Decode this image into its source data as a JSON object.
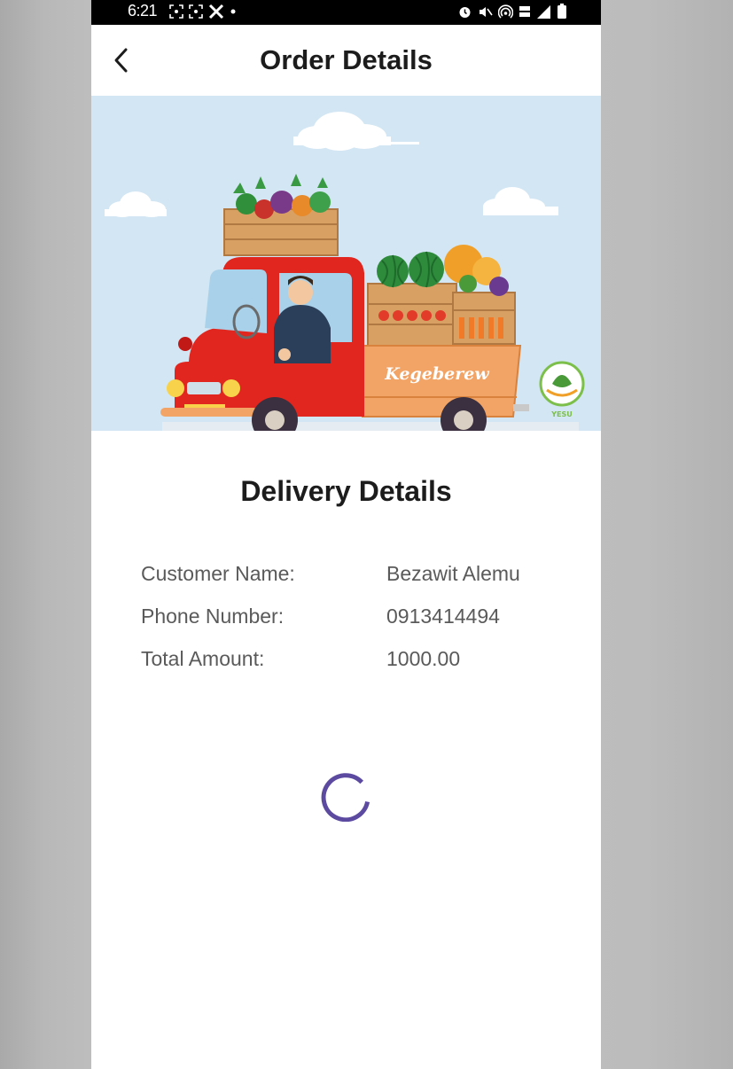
{
  "status_bar": {
    "time": "6:21",
    "left_icons": [
      "screenshot-icon",
      "screenshot-icon",
      "x-app-icon",
      "dot-icon"
    ],
    "right_icons": [
      "alarm-icon",
      "mute-icon",
      "hotspot-icon",
      "volte-icon",
      "signal-icon",
      "battery-icon"
    ]
  },
  "app_bar": {
    "title": "Order Details",
    "back_icon": "chevron-left-icon"
  },
  "banner": {
    "truck_label": "Kegeberew",
    "logo_text": "YESU"
  },
  "delivery": {
    "title": "Delivery Details",
    "rows": [
      {
        "label": "Customer Name:",
        "value": "Bezawit Alemu"
      },
      {
        "label": "Phone Number:",
        "value": "0913414494"
      },
      {
        "label": "Total Amount:",
        "value": "1000.00"
      }
    ]
  },
  "loading": {
    "spinner_color": "#5b4aa0"
  },
  "colors": {
    "sky": "#d3e6f3",
    "truck_red": "#e0261e",
    "truck_bed_orange": "#f0a060"
  }
}
